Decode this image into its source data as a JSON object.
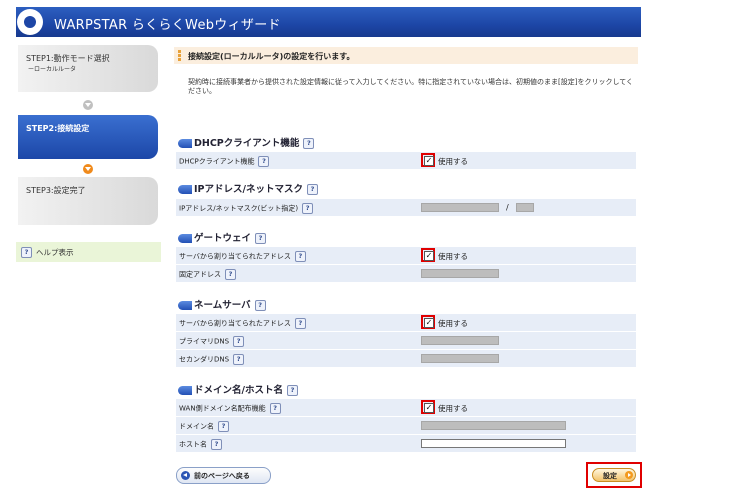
{
  "header": {
    "title": "WARPSTAR らくらくWebウィザード"
  },
  "sidebar": {
    "steps": [
      {
        "label": "STEP1:動作モード選択",
        "sub": "ーローカルルータ"
      },
      {
        "label": "STEP2:接続設定"
      },
      {
        "label": "STEP3:設定完了"
      }
    ],
    "help_label": "ヘルプ表示"
  },
  "main": {
    "notice": "接続設定(ローカルルータ)の設定を行います。",
    "description": "契約時に接続事業者から提供された設定情報に従って入力してください。特に指定されていない場合は、初期値のまま[設定]をクリックしてください。",
    "sections": [
      {
        "title": "DHCPクライアント機能",
        "rows": [
          {
            "label": "DHCPクライアント機能",
            "checkbox": "使用する",
            "checked": true
          }
        ]
      },
      {
        "title": "IPアドレス/ネットマスク",
        "rows": [
          {
            "label": "IPアドレス/ネットマスク(ビット指定)",
            "separator": "/"
          }
        ]
      },
      {
        "title": "ゲートウェイ",
        "rows": [
          {
            "label": "サーバから割り当てられたアドレス",
            "checkbox": "使用する",
            "checked": true
          },
          {
            "label": "固定アドレス"
          }
        ]
      },
      {
        "title": "ネームサーバ",
        "rows": [
          {
            "label": "サーバから割り当てられたアドレス",
            "checkbox": "使用する",
            "checked": true
          },
          {
            "label": "プライマリDNS"
          },
          {
            "label": "セカンダリDNS"
          }
        ]
      },
      {
        "title": "ドメイン名/ホスト名",
        "rows": [
          {
            "label": "WAN側ドメイン名配布機能",
            "checkbox": "使用する",
            "checked": true
          },
          {
            "label": "ドメイン名"
          },
          {
            "label": "ホスト名"
          }
        ]
      }
    ],
    "back_label": "前のページへ戻る",
    "submit_label": "設定"
  },
  "icons": {
    "help": "?",
    "check": "✓"
  }
}
